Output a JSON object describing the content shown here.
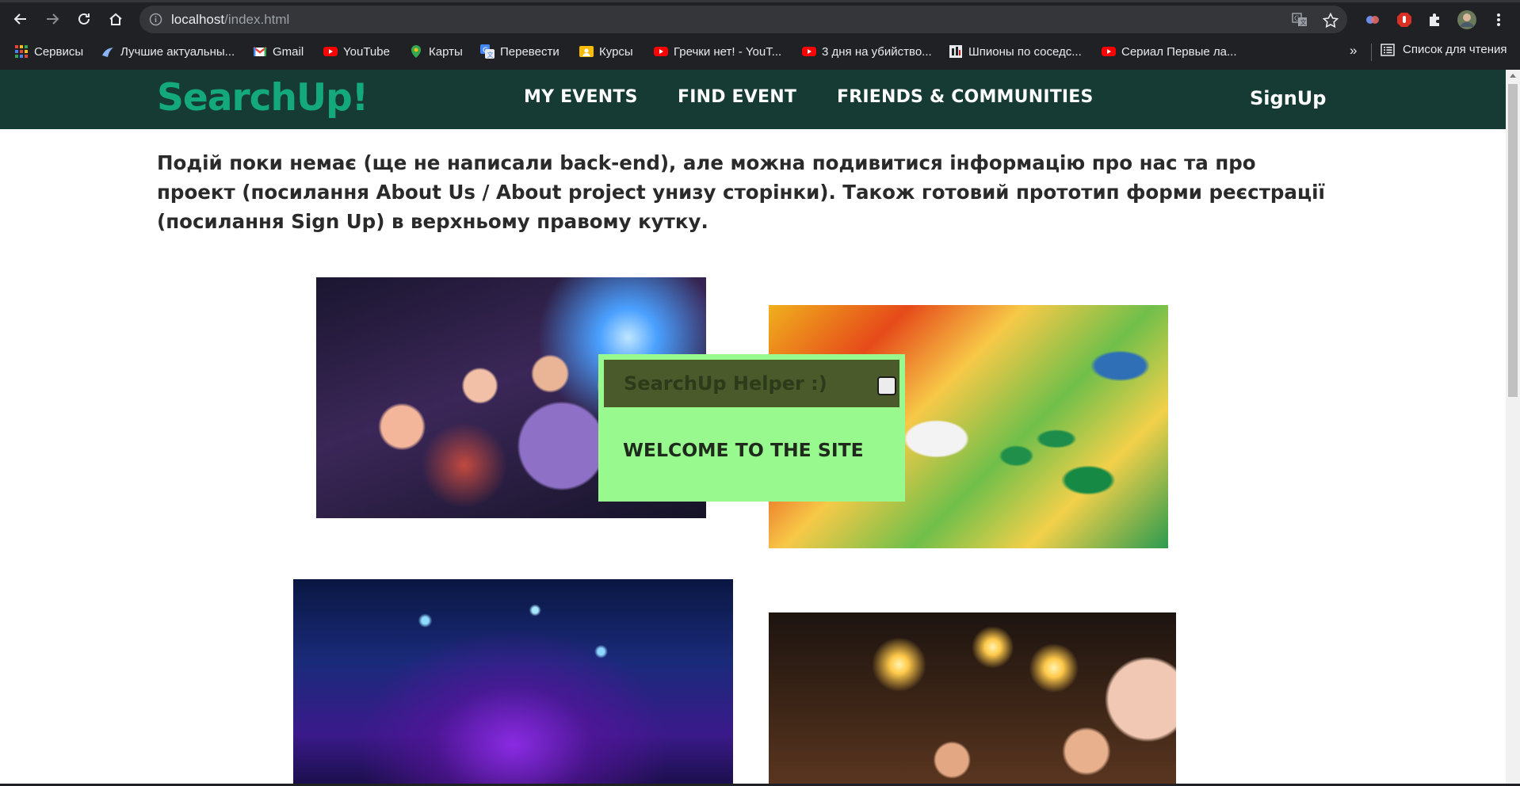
{
  "browser": {
    "url_host": "localhost",
    "url_path": "/index.html",
    "bookmarks": [
      {
        "label": "Сервисы",
        "icon": "apps-grid-icon",
        "color": "#4285f4"
      },
      {
        "label": "Лучшие актуальны...",
        "icon": "bookmark-page-icon",
        "color": "#8ab4f8"
      },
      {
        "label": "Gmail",
        "icon": "gmail-icon",
        "color": "#ea4335"
      },
      {
        "label": "YouTube",
        "icon": "youtube-icon",
        "color": "#ff0000"
      },
      {
        "label": "Карты",
        "icon": "maps-pin-icon",
        "color": "#34a853"
      },
      {
        "label": "Перевести",
        "icon": "translate-icon",
        "color": "#4285f4"
      },
      {
        "label": "Курсы",
        "icon": "courses-icon",
        "color": "#fbbc04"
      },
      {
        "label": "Гречки нет! - YouT...",
        "icon": "youtube-icon",
        "color": "#ff0000"
      },
      {
        "label": "3 дня на убийство...",
        "icon": "youtube-icon",
        "color": "#ff0000"
      },
      {
        "label": "Шпионы по соседс...",
        "icon": "site-icon",
        "color": "#e8eaed"
      },
      {
        "label": "Сериал Первые ла...",
        "icon": "youtube-icon",
        "color": "#ff0000"
      }
    ],
    "more_bookmarks": "»",
    "reading_list": "Список для чтения"
  },
  "site": {
    "logo": "SearchUp!",
    "nav": {
      "my_events": "MY EVENTS",
      "find_event": "FIND EVENT",
      "friends": "FRIENDS & COMMUNITIES"
    },
    "signup": "SignUp",
    "intro": "Подій поки немає (ще не написали back-end), але можна подивитися інформацію про нас та про проект (посилання About Us / About project унизу сторінки). Також готовий прототип форми реєстрації (посилання Sign Up) в верхньому правому кутку.",
    "images": [
      "party-photo",
      "board-game-photo",
      "concert-stage-photo",
      "sparklers-celebration-photo"
    ]
  },
  "helper": {
    "title": "SearchUp Helper :)",
    "message": "WELCOME TO THE SITE"
  },
  "colors": {
    "header_bg": "#163b35",
    "logo": "#14a97b",
    "helper_bg": "#98f98f",
    "helper_head": "#4b5a2a"
  }
}
